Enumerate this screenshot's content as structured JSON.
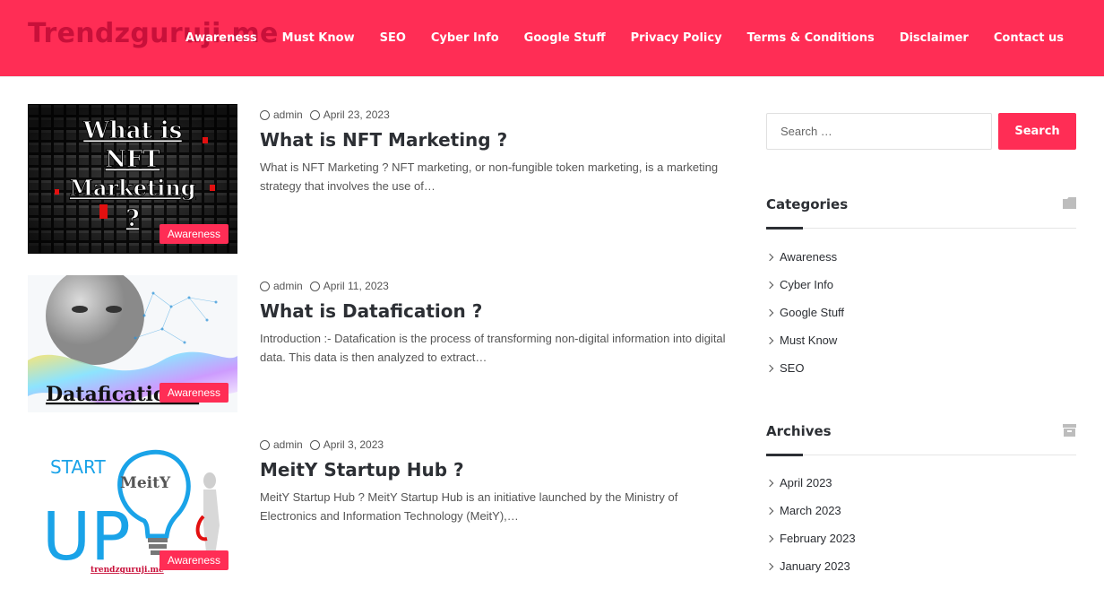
{
  "header": {
    "logo": "Trendzguruji.me",
    "nav": [
      "Awareness",
      "Must Know",
      "SEO",
      "Cyber Info",
      "Google Stuff",
      "Privacy Policy",
      "Terms & Conditions",
      "Disclaimer",
      "Contact us"
    ]
  },
  "posts": [
    {
      "author": "admin",
      "date": "April 23, 2023",
      "title": "What is NFT Marketing ?",
      "excerpt": "What is NFT Marketing ? NFT marketing, or non-fungible token marketing, is a marketing strategy that involves the use of…",
      "category": "Awareness",
      "image_text": [
        "What is",
        "NFT",
        "Marketing",
        "?"
      ]
    },
    {
      "author": "admin",
      "date": "April 11, 2023",
      "title": "What is Datafication ?",
      "excerpt": "Introduction :- Datafication is the process of transforming non-digital information into digital data. This data is then analyzed to extract…",
      "category": "Awareness",
      "image_text": [
        "Datafication ?"
      ]
    },
    {
      "author": "admin",
      "date": "April 3, 2023",
      "title": "MeitY Startup Hub ?",
      "excerpt": "MeitY Startup Hub ? MeitY Startup Hub is an initiative launched by the Ministry of Electronics and Information Technology (MeitY),…",
      "category": "Awareness",
      "image_text": [
        "START",
        "UP",
        "MeitY",
        "trendzguruji.me"
      ]
    }
  ],
  "sidebar": {
    "search_placeholder": "Search …",
    "search_button": "Search",
    "categories_title": "Categories",
    "categories": [
      "Awareness",
      "Cyber Info",
      "Google Stuff",
      "Must Know",
      "SEO"
    ],
    "archives_title": "Archives",
    "archives": [
      "April 2023",
      "March 2023",
      "February 2023",
      "January 2023"
    ]
  },
  "colors": {
    "brand": "#ff2d55",
    "logo": "#c8103a",
    "text": "#2c2f34"
  }
}
